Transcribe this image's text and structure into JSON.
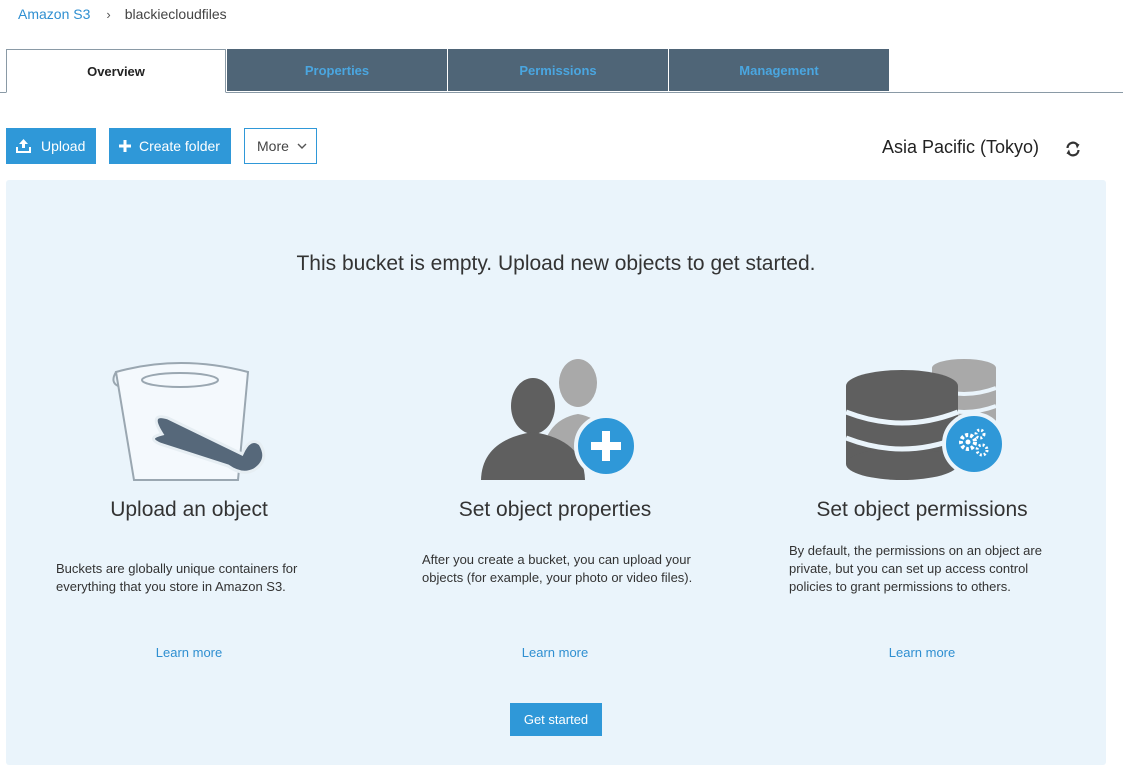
{
  "breadcrumb": {
    "root": "Amazon S3",
    "separator": "›",
    "current": "blackiecloudfiles"
  },
  "tabs": [
    {
      "label": "Overview",
      "active": true
    },
    {
      "label": "Properties",
      "active": false
    },
    {
      "label": "Permissions",
      "active": false
    },
    {
      "label": "Management",
      "active": false
    }
  ],
  "toolbar": {
    "upload_label": "Upload",
    "create_folder_label": "Create folder",
    "more_label": "More",
    "region": "Asia Pacific (Tokyo)"
  },
  "panel": {
    "empty_message": "This bucket is empty. Upload new objects to get started.",
    "features": [
      {
        "title": "Upload an object",
        "description": "Buckets are globally unique containers for everything that you store in Amazon S3.",
        "link": "Learn more",
        "icon": "bucket-icon"
      },
      {
        "title": "Set object properties",
        "description": "After you create a bucket, you can upload your objects (for example, your photo or video files).",
        "link": "Learn more",
        "icon": "users-add-icon"
      },
      {
        "title": "Set object permissions",
        "description": "By default, the permissions on an object are private, but you can set up access control policies to grant permissions to others.",
        "link": "Learn more",
        "icon": "database-gear-icon"
      }
    ],
    "get_started_label": "Get started"
  },
  "colors": {
    "accent": "#2f98d8",
    "tab_bg": "#4f6577",
    "panel_bg": "#eaf4fb"
  }
}
